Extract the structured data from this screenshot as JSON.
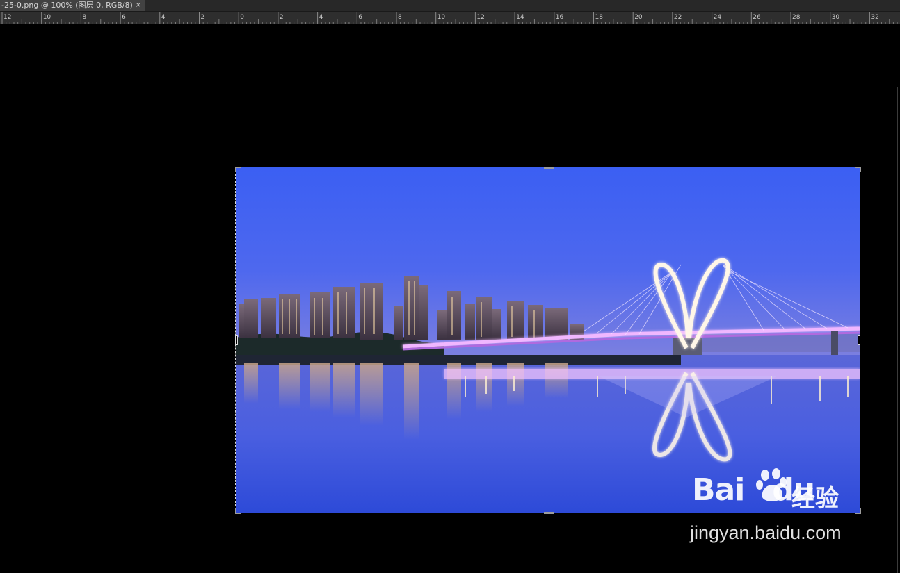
{
  "document_tab": {
    "title": "-25-0.png @ 100% (图层 0, RGB/8)",
    "close_glyph": "×"
  },
  "ruler": {
    "labels": [
      "12",
      "10",
      "8",
      "6",
      "4",
      "2",
      "0",
      "2",
      "4",
      "6",
      "8",
      "10",
      "12",
      "14",
      "16",
      "18",
      "20",
      "22",
      "24",
      "26",
      "28",
      "30",
      "32"
    ]
  },
  "watermark": {
    "brand_bai": "Bai",
    "brand_du": "du",
    "brand_cn": "经验",
    "url": "jingyan.baidu.com"
  },
  "colors": {
    "sky_top": "#3d63f2",
    "sky_horizon": "#6b78e6",
    "water_bottom": "#2f4fd6",
    "bridge_light": "#e9a8ff"
  },
  "icons": {
    "paw": "baidu-paw-icon"
  }
}
